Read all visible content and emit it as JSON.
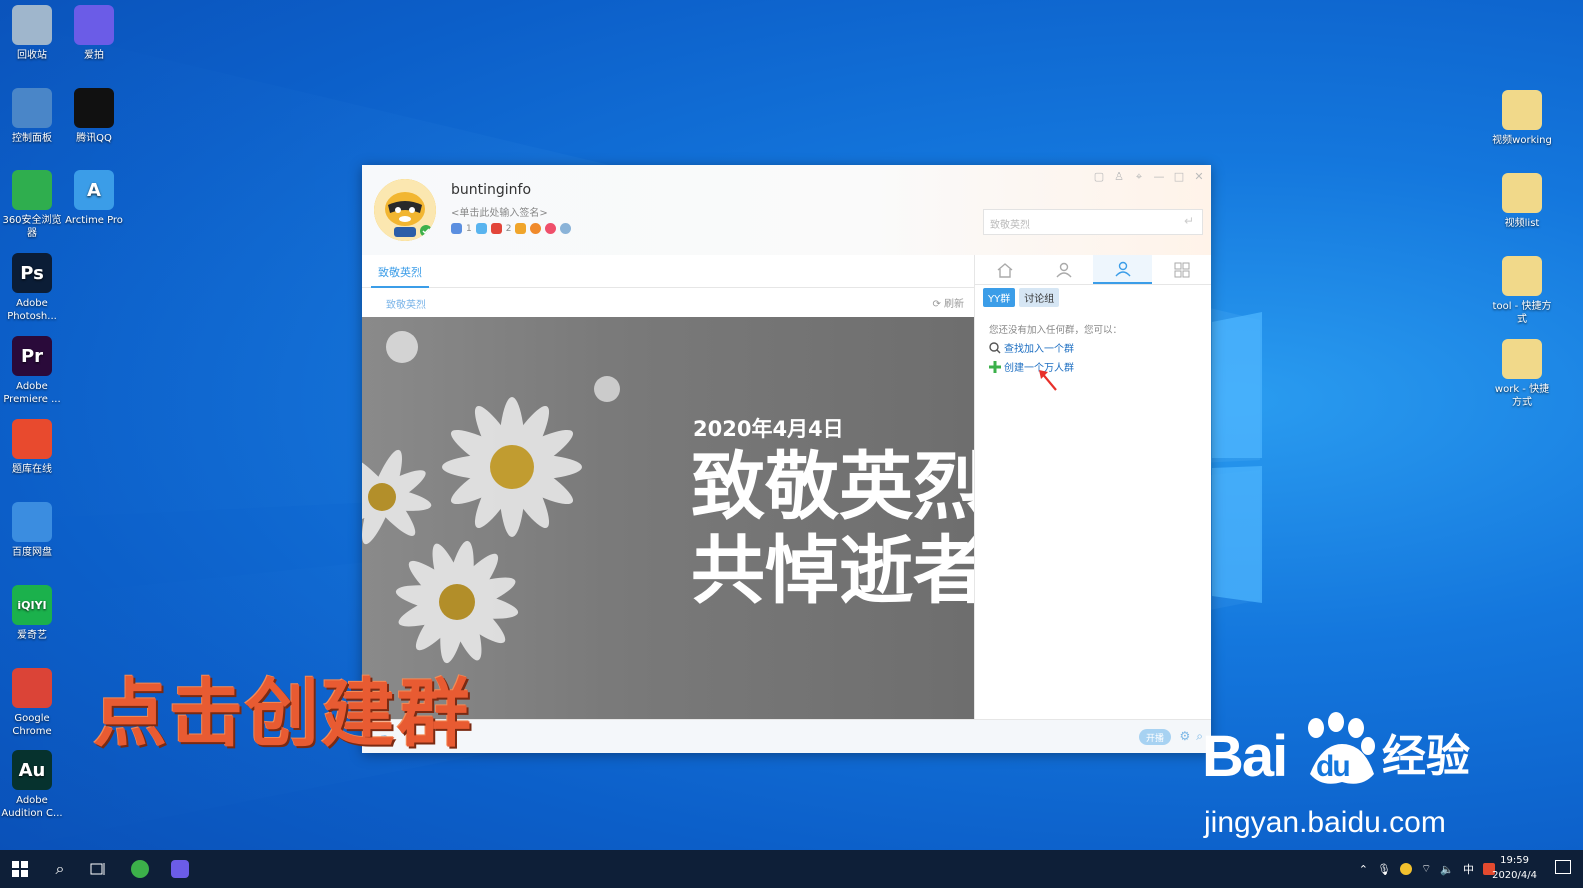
{
  "desktop": {
    "left_icons": [
      {
        "label": "回收站",
        "icon": "recycle-bin-icon",
        "color": "#9fb6cc"
      },
      {
        "label": "控制面板",
        "icon": "control-panel-icon",
        "color": "#4a86c8"
      },
      {
        "label": "360安全浏览器",
        "icon": "browser-360-icon",
        "color": "#2fae4e"
      },
      {
        "label": "Adobe Photosh...",
        "icon": "photoshop-icon",
        "color": "#0b1d36",
        "glyph": "Ps"
      },
      {
        "label": "Adobe Premiere ...",
        "icon": "premiere-icon",
        "color": "#2a0a3a",
        "glyph": "Pr"
      },
      {
        "label": "题库在线",
        "icon": "tiku-icon",
        "color": "#e84a2e"
      },
      {
        "label": "百度网盘",
        "icon": "baidu-netdisk-icon",
        "color": "#3b8de0"
      },
      {
        "label": "爱奇艺",
        "icon": "iqiyi-icon",
        "color": "#1bb14c",
        "glyph": "iQIYI"
      },
      {
        "label": "Google Chrome",
        "icon": "chrome-icon",
        "color": "#db4437"
      },
      {
        "label": "Adobe Audition C...",
        "icon": "audition-icon",
        "color": "#06322e",
        "glyph": "Au"
      }
    ],
    "second_col_icons": [
      {
        "label": "爱拍",
        "icon": "aipai-icon",
        "color": "#6b5ce7"
      },
      {
        "label": "腾讯QQ",
        "icon": "qq-icon",
        "color": "#111111"
      },
      {
        "label": "Arctime Pro",
        "icon": "arctime-icon",
        "color": "#3b9de8",
        "glyph": "A"
      }
    ],
    "right_icons": [
      {
        "label": "视频working",
        "icon": "folder-shortcut-icon"
      },
      {
        "label": "视频list",
        "icon": "folder-shortcut-icon"
      },
      {
        "label": "tool - 快捷方式",
        "icon": "folder-shortcut-icon"
      },
      {
        "label": "work - 快捷方式",
        "icon": "folder-shortcut-icon"
      }
    ]
  },
  "app": {
    "username": "buntinginfo",
    "signature": "<单击此处输入签名>",
    "badge_counts": [
      "1",
      "2"
    ],
    "search_placeholder": "致敬英烈",
    "tab_active": "致敬英烈",
    "sub_label": "致敬英烈",
    "refresh_label": "刷新",
    "banner": {
      "date": "2020年4月4日",
      "line1": "致敬英烈",
      "line2": "共悼逝者"
    },
    "right": {
      "nav_tabs": [
        "home-icon",
        "contact-icon",
        "group-icon",
        "apps-icon"
      ],
      "group_tab_on": "YY群",
      "group_tab_off": "讨论组",
      "hint": "您还没有加入任何群，您可以：",
      "find_link": "查找加入一个群",
      "create_link": "创建一个万人群"
    },
    "broadcast_label": "开播"
  },
  "overlay_caption": "点击创建群",
  "watermark": {
    "logo": "Bai du",
    "cn": "经验",
    "url": "jingyan.baidu.com"
  },
  "taskbar": {
    "time": "19:59",
    "date": "2020/4/4",
    "ime": "中",
    "colors": {
      "bar": "#0e1f38"
    }
  }
}
